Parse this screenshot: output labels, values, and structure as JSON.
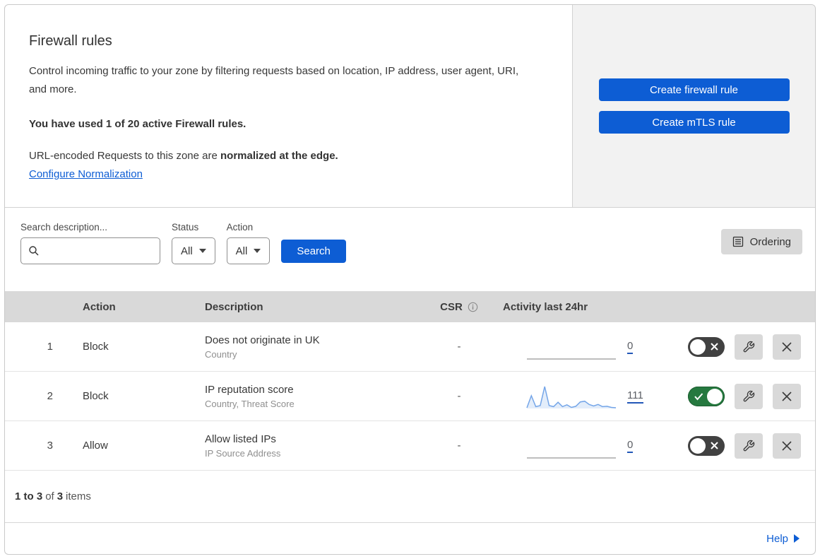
{
  "header": {
    "title": "Firewall rules",
    "description": "Control incoming traffic to your zone by filtering requests based on location, IP address, user agent, URI, and more.",
    "usage_text": "You have used 1 of 20 active Firewall rules.",
    "normalization_prefix": "URL-encoded Requests to this zone are ",
    "normalization_bold": "normalized at the edge.",
    "normalization_link": "Configure Normalization",
    "create_firewall_button": "Create firewall rule",
    "create_mtls_button": "Create mTLS rule"
  },
  "filters": {
    "search_label": "Search description...",
    "search_placeholder": "",
    "status_label": "Status",
    "status_value": "All",
    "action_label": "Action",
    "action_value": "All",
    "search_button": "Search",
    "ordering_button": "Ordering"
  },
  "table": {
    "columns": {
      "action": "Action",
      "description": "Description",
      "csr": "CSR",
      "activity": "Activity last 24hr"
    },
    "rows": [
      {
        "priority": "1",
        "action": "Block",
        "description": "Does not originate in UK",
        "fields": "Country",
        "csr": "-",
        "activity_count": "0",
        "enabled": false,
        "sparkline": {
          "values": [
            0,
            0,
            0,
            0,
            0,
            0,
            0,
            0,
            0,
            0,
            0,
            0
          ],
          "color": "#a9a9a9",
          "fill": "none"
        }
      },
      {
        "priority": "2",
        "action": "Block",
        "description": "IP reputation score",
        "fields": "Country, Threat Score",
        "csr": "-",
        "activity_count": "111",
        "enabled": true,
        "sparkline": {
          "values": [
            2,
            35,
            5,
            8,
            60,
            8,
            5,
            17,
            5,
            10,
            3,
            6,
            18,
            20,
            11,
            7,
            11,
            5,
            6,
            3,
            2
          ],
          "color": "#74a5e8",
          "fill": "#e3edfa"
        }
      },
      {
        "priority": "3",
        "action": "Allow",
        "description": "Allow listed IPs",
        "fields": "IP Source Address",
        "csr": "-",
        "activity_count": "0",
        "enabled": false,
        "sparkline": {
          "values": [
            0,
            0,
            0,
            0,
            0,
            0,
            0,
            0,
            0,
            0,
            0,
            0
          ],
          "color": "#a9a9a9",
          "fill": "none"
        }
      }
    ]
  },
  "footer": {
    "range": "1 to 3",
    "of": "of",
    "total": "3",
    "items": "items",
    "help": "Help"
  },
  "colors": {
    "primary_blue": "#0d5dd4",
    "link_blue": "#0d5dd4",
    "toggle_on_green": "#26793f",
    "toggle_off_gray": "#414141",
    "table_header_gray": "#d9d9d9",
    "side_panel_gray": "#f2f2f2",
    "sparkline_blue": "#74a5e8"
  }
}
